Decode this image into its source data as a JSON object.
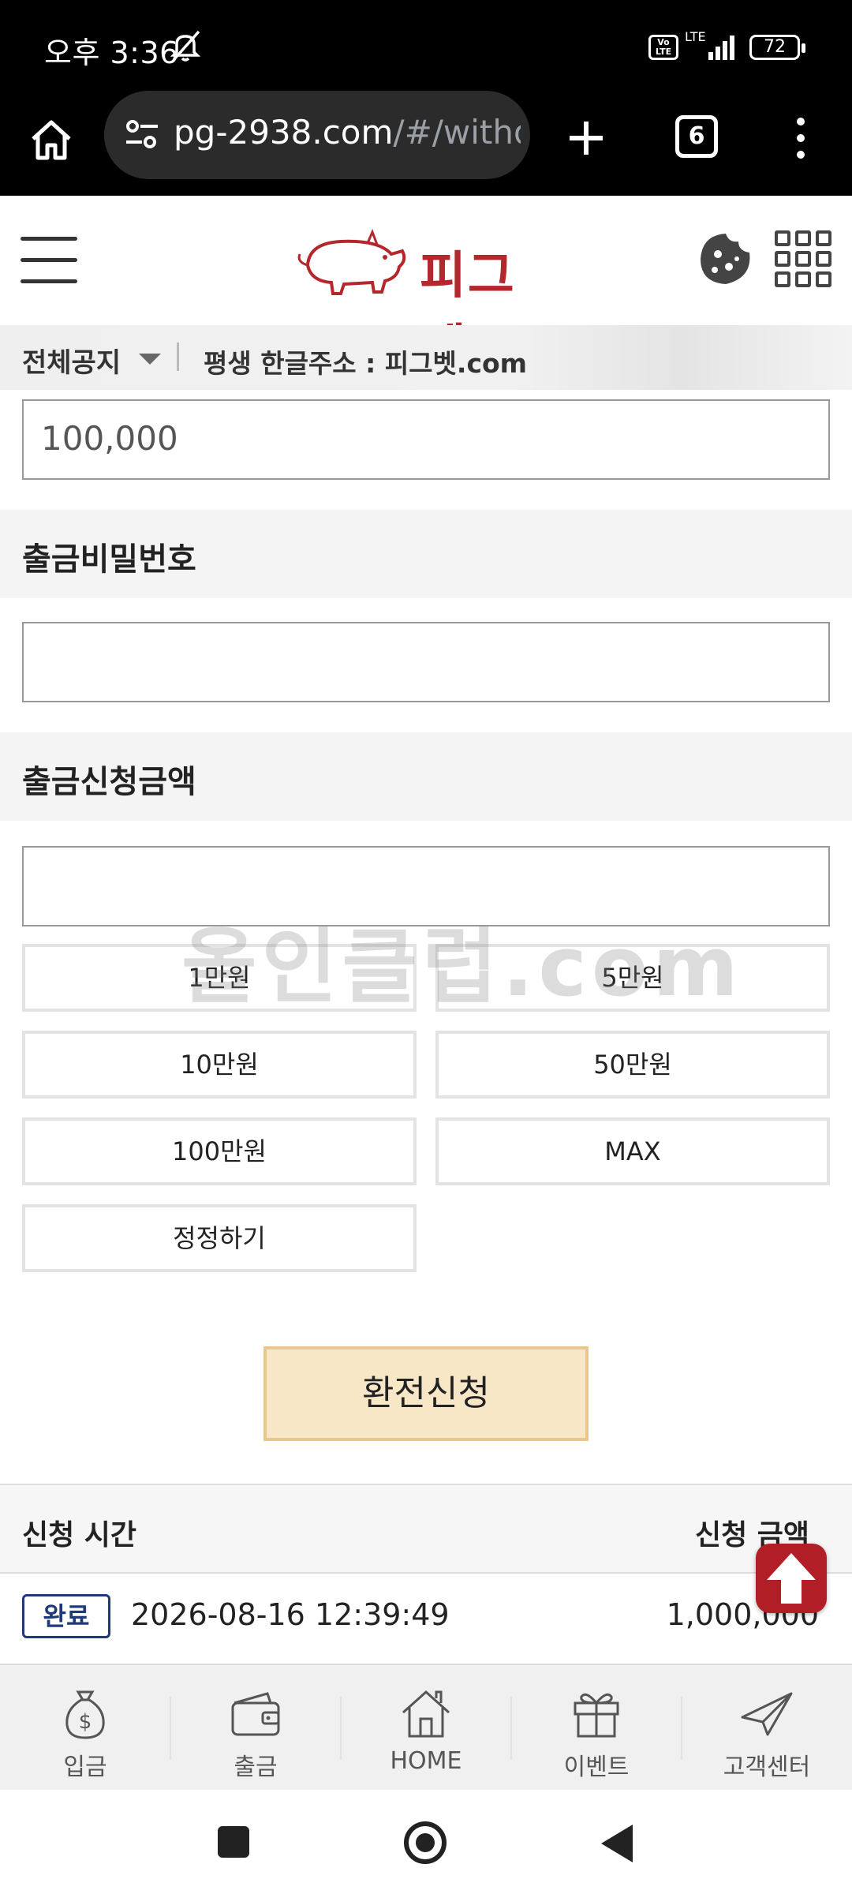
{
  "status_bar": {
    "time": "오후 3:36",
    "network_volte": "Vo LTE",
    "network_lte": "LTE",
    "battery": "72"
  },
  "browser": {
    "url_host": "pg-2938.com",
    "url_path": "/#/withd",
    "tab_count": "6"
  },
  "site": {
    "logo_text": "피그벳",
    "accent_color": "#b3272d"
  },
  "notice": {
    "label": "전체공지",
    "text": "평생 한글주소 : 피그벳.com"
  },
  "form": {
    "amount_value": "100,000",
    "password_section": "출금비밀번호",
    "password_value": "",
    "request_section": "출금신청금액",
    "request_value": "",
    "quick_amounts": [
      "1만원",
      "5만원",
      "10만원",
      "50만원",
      "100만원",
      "MAX"
    ],
    "reset_label": "정정하기",
    "submit_label": "환전신청"
  },
  "watermark": "올인클럽.com",
  "history": {
    "col_time": "신청 시간",
    "col_amount": "신청 금액",
    "rows": [
      {
        "status": "완료",
        "datetime": "2026-08-16 12:39:49",
        "amount": "1,000,000"
      }
    ]
  },
  "bottom_nav": {
    "items": [
      {
        "label": "입금",
        "icon": "money-bag-icon"
      },
      {
        "label": "출금",
        "icon": "wallet-icon"
      },
      {
        "label": "HOME",
        "icon": "house-icon"
      },
      {
        "label": "이벤트",
        "icon": "gift-icon"
      },
      {
        "label": "고객센터",
        "icon": "paper-plane-icon"
      }
    ]
  }
}
